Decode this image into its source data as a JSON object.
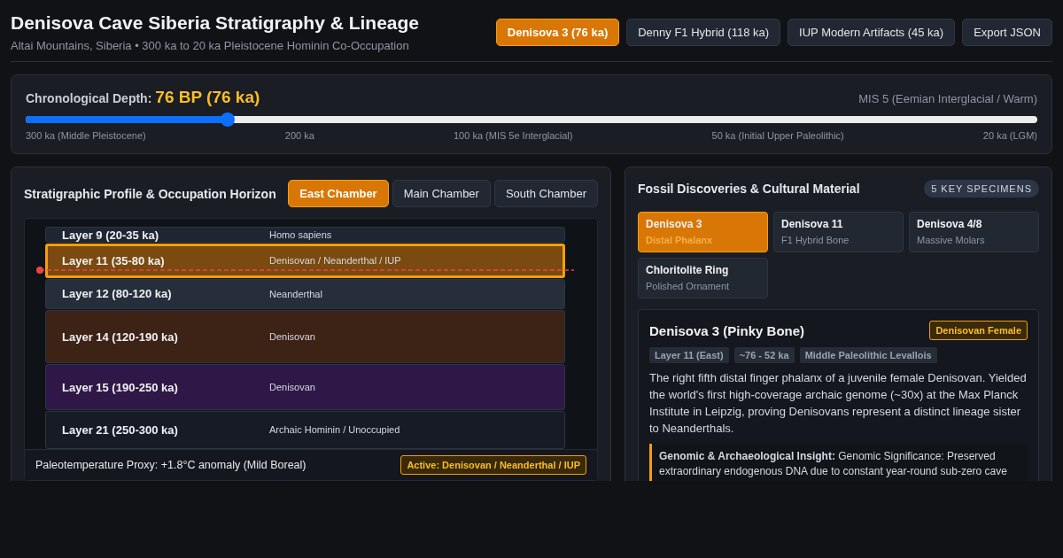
{
  "header": {
    "title": "Denisova Cave Siberia Stratigraphy & Lineage",
    "subtitle": "Altai Mountains, Siberia • 300 ka to 20 ka Pleistocene Hominin Co-Occupation",
    "presets": [
      {
        "label": "Denisova 3 (76 ka)",
        "selected": true
      },
      {
        "label": "Denny F1 Hybrid (118 ka)",
        "selected": false
      },
      {
        "label": "IUP Modern Artifacts (45 ka)",
        "selected": false
      }
    ],
    "export_button": "Export JSON"
  },
  "timeline": {
    "label": "Chronological Depth:",
    "value": "76 BP (76 ka)",
    "climate": "MIS 5 (Eemian Interglacial / Warm)",
    "level": 0.2,
    "ticks": [
      "300 ka (Middle Pleistocene)",
      "200 ka",
      "100 ka (MIS 5e Interglacial)",
      "50 ka (Initial Upper Paleolithic)",
      "20 ka (LGM)"
    ]
  },
  "profile": {
    "title": "Stratigraphic Profile & Occupation Horizon",
    "chambers": [
      {
        "label": "East Chamber",
        "selected": true
      },
      {
        "label": "Main Chamber",
        "selected": false
      },
      {
        "label": "South Chamber",
        "selected": false
      }
    ],
    "layers": [
      {
        "name": "Layer 9 (20-35 ka)",
        "occupants": "Homo sapiens",
        "color": "#1f2633",
        "selected": false
      },
      {
        "name": "Layer 11 (35-80 ka)",
        "occupants": "Denisovan / Neanderthal / IUP",
        "color": "#7a4a10",
        "selected": true
      },
      {
        "name": "Layer 12 (80-120 ka)",
        "occupants": "Neanderthal",
        "color": "#262e3b",
        "selected": false
      },
      {
        "name": "Layer 14 (120-190 ka)",
        "occupants": "Denisovan",
        "color": "#3d2216",
        "selected": false
      },
      {
        "name": "Layer 15 (190-250 ka)",
        "occupants": "Denisovan",
        "color": "#2f1848",
        "selected": false
      },
      {
        "name": "Layer 21 (250-300 ka)",
        "occupants": "Archaic Hominin / Unoccupied",
        "color": "#161b26",
        "selected": false
      }
    ],
    "proxy": "Paleotemperature Proxy: +1.8°C anomaly (Mild Boreal)",
    "active": "Active: Denisovan / Neanderthal / IUP"
  },
  "fossils": {
    "title": "Fossil Discoveries & Cultural Material",
    "count": "5 KEY SPECIMENS",
    "specimens": [
      {
        "name": "Denisova 3",
        "type": "Distal Phalanx",
        "selected": true
      },
      {
        "name": "Denisova 11",
        "type": "F1 Hybrid Bone",
        "selected": false
      },
      {
        "name": "Denisova 4/8",
        "type": "Massive Molars",
        "selected": false
      },
      {
        "name": "Chloritolite Ring",
        "type": "Polished Ornament",
        "selected": false
      }
    ],
    "detail": {
      "title": "Denisova 3 (Pinky Bone)",
      "badge": "Denisovan Female",
      "tags": [
        "Layer 11 (East)",
        "~76 - 52 ka",
        "Middle Paleolithic Levallois"
      ],
      "description": "The right fifth distal finger phalanx of a juvenile female Denisovan. Yielded the world's first high-coverage archaic genome (~30x) at the Max Planck Institute in Leipzig, proving Denisovans represent a distinct lineage sister to Neanderthals.",
      "insight": "**Genomic & Archaeological Insight:** Genomic Significance: Preserved extraordinary endogenous DNA due to constant year-round sub-zero cave"
    }
  }
}
